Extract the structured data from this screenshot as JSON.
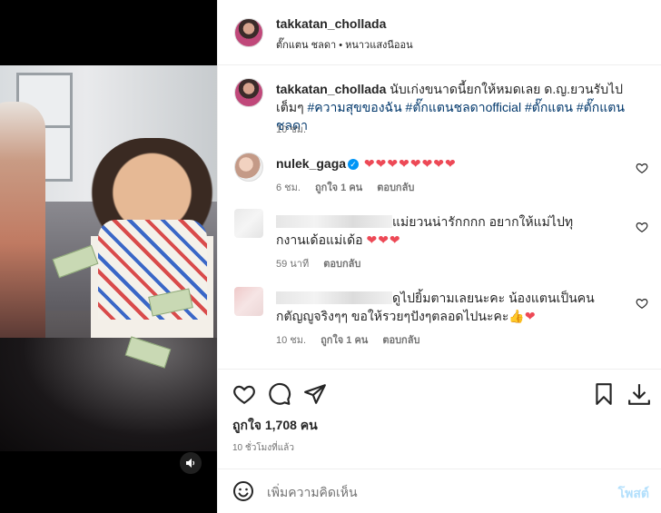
{
  "media": {
    "mute_icon": "speaker-icon"
  },
  "header": {
    "username": "takkatan_chollada",
    "subtitle": "ตั๊กแตน ชลดา • หนาวแสงนีออน"
  },
  "caption": {
    "username": "takkatan_chollada",
    "text": "นับเก่งขนาดนี้ยกให้หมดเลย ด.ญ.ยวนรับไปเต็มๆ",
    "hashtags": "#ความสุขของฉัน #ตั๊กแตนชลดาofficial #ตั๊กแตน #ตั๊กแตนชลดา",
    "time": "10 ชม."
  },
  "comments": [
    {
      "username": "nulek_gaga",
      "verified": true,
      "text": "❤❤❤❤❤❤❤❤",
      "time": "6 ชม.",
      "likes": "ถูกใจ 1 คน",
      "reply": "ตอบกลับ"
    },
    {
      "username": "",
      "text_plain": "แม่ยวนน่ารักกกก อยากให้แม่ไปทุกงานเด้อแม่เด้อ",
      "hearts": "❤❤❤",
      "time": "59 นาที",
      "reply": "ตอบกลับ"
    },
    {
      "username": "",
      "text_plain": "ดูไปยิ้มตามเลยนะคะ น้องแตนเป็นคนกตัญญูจริงๆๆ ขอให้รวยๆปังๆตลอดไปนะคะ👍",
      "hearts": "❤",
      "time": "10 ชม.",
      "likes": "ถูกใจ 1 คน",
      "reply": "ตอบกลับ"
    }
  ],
  "engagement": {
    "likes": "ถูกใจ 1,708 คน",
    "time": "10 ชั่วโมงที่แล้ว"
  },
  "add_comment": {
    "placeholder": "เพิ่มความคิดเห็น",
    "post_label": "โพสต์"
  },
  "colors": {
    "heart": "#ed4956",
    "verified": "#0095f6",
    "hashtag": "#00376b",
    "post_disabled": "#b2dffc"
  }
}
